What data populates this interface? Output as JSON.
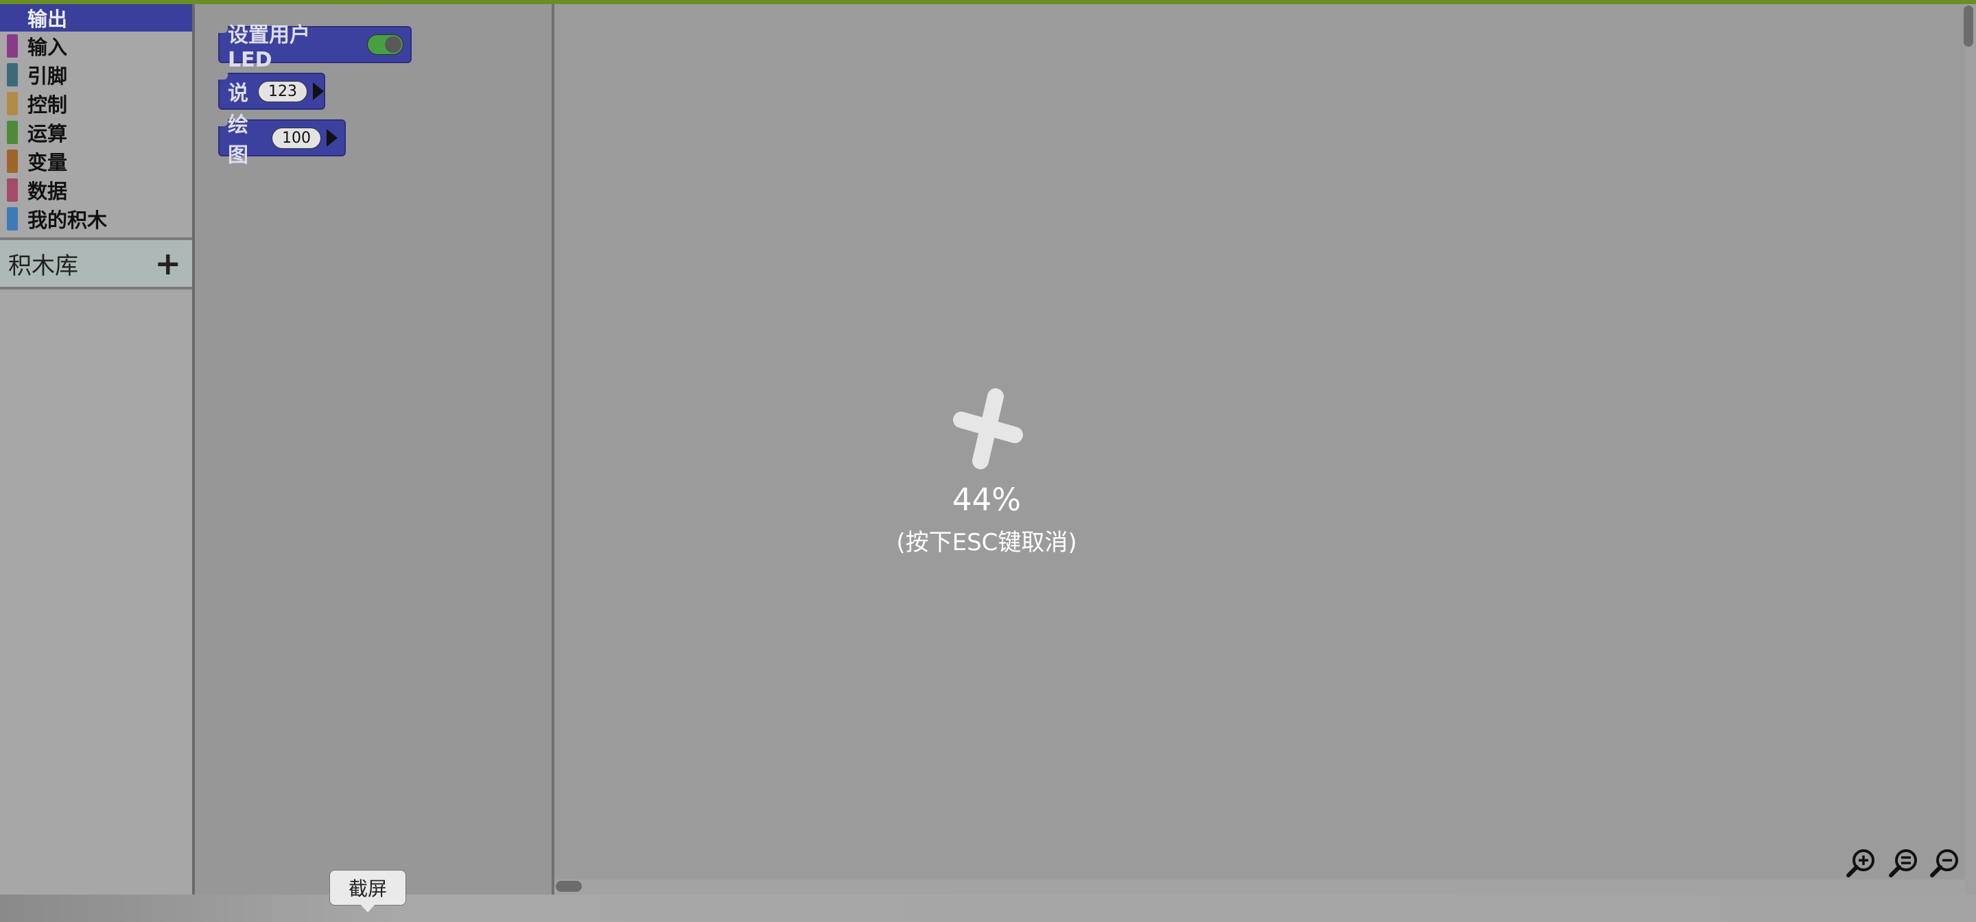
{
  "sidebar": {
    "categories": [
      {
        "label": "输出",
        "color": "#3a3f9b",
        "selected": true
      },
      {
        "label": "输入",
        "color": "#8a3a8a"
      },
      {
        "label": "引脚",
        "color": "#3c6a78"
      },
      {
        "label": "控制",
        "color": "#b08c46"
      },
      {
        "label": "运算",
        "color": "#4f8a3a"
      },
      {
        "label": "变量",
        "color": "#a0642a"
      },
      {
        "label": "数据",
        "color": "#a44a6a"
      },
      {
        "label": "我的积木",
        "color": "#3f7ab8"
      }
    ],
    "library_label": "积木库",
    "library_add": "+"
  },
  "flyout": {
    "block_led": {
      "label": "设置用户 LED",
      "toggle_on": true
    },
    "block_say": {
      "label": "说",
      "value": "123"
    },
    "block_plot": {
      "label": "绘图",
      "value": "100"
    }
  },
  "workspace": {
    "loading": {
      "percent": "44%",
      "cancel_hint": "(按下ESC键取消)"
    }
  },
  "zoom": {
    "zoom_in": "zoom-in-icon",
    "zoom_reset": "zoom-reset-icon",
    "zoom_out": "zoom-out-icon"
  },
  "tooltip": {
    "text": "截屏"
  },
  "colors": {
    "accent": "#6b8e23",
    "block": "#3c41a0"
  }
}
